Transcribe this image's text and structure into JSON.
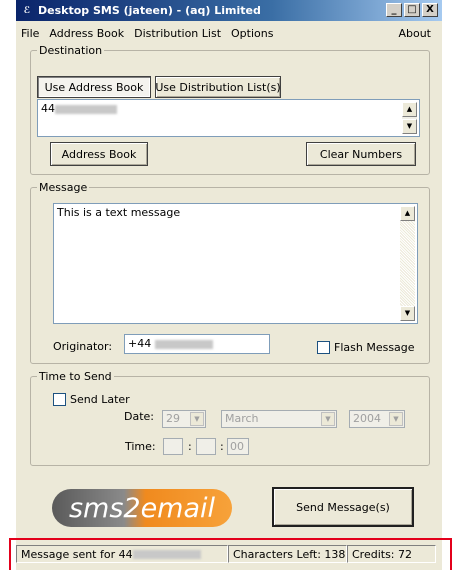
{
  "window": {
    "app_icon": "sms-app-icon",
    "title": "Desktop SMS (jateen) - (aq) Limited",
    "controls": [
      "_",
      "□",
      "X"
    ]
  },
  "menu": {
    "file": "File",
    "address_book": "Address Book",
    "distribution_list": "Distribution List",
    "options": "Options",
    "about": "About"
  },
  "destination": {
    "legend": "Destination",
    "tab_address_book": "Use Address Book",
    "tab_distribution": "Use Distribution List(s)",
    "numbers_prefix": "44",
    "address_book_button": "Address Book",
    "clear_numbers_button": "Clear Numbers"
  },
  "message": {
    "legend": "Message",
    "text": "This is a text message",
    "originator_label": "Originator:",
    "originator_prefix": "+44",
    "flash_label": "Flash Message"
  },
  "time_to_send": {
    "legend": "Time to Send",
    "send_later_label": "Send Later",
    "date_label": "Date:",
    "day": "29",
    "month": "March",
    "year": "2004",
    "time_label": "Time:",
    "time_sep": ":",
    "seconds": "00"
  },
  "logo": {
    "text": "sms2email"
  },
  "send_button": "Send Message(s)",
  "status": {
    "sent_prefix": "Message sent for 44",
    "chars_left": "Characters Left: 138",
    "credits": "Credits: 72"
  }
}
